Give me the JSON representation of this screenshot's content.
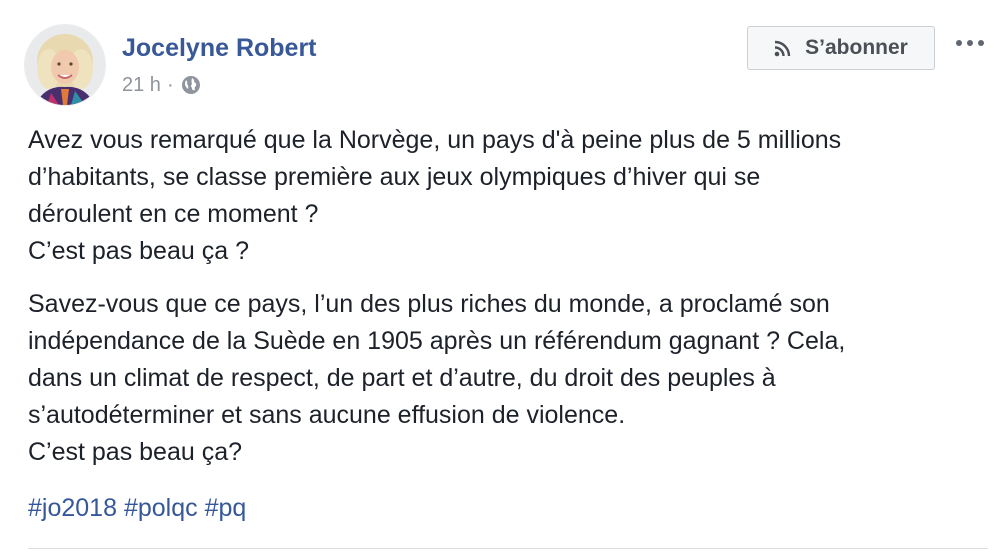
{
  "post": {
    "author": {
      "name": "Jocelyne Robert"
    },
    "meta": {
      "time": "21 h",
      "separator": "·",
      "audience_icon": "globe-icon"
    },
    "subscribe_button": {
      "label": "S’abonner",
      "icon": "rss-icon"
    },
    "more_button": {
      "icon": "more-options-icon"
    },
    "body": {
      "paragraph1_lines": [
        "Avez vous remarqué que la Norvège, un pays d'à peine plus de 5 millions",
        "d’habitants, se classe première aux jeux olympiques d’hiver qui se",
        "déroulent en ce moment ?",
        "C’est pas beau ça ?"
      ],
      "paragraph2_lines": [
        "Savez-vous que ce pays, l’un des plus riches du monde, a proclamé son",
        "indépendance de la Suède en 1905 après un référendum gagnant ? Cela,",
        "dans un climat de respect, de part et d’autre, du droit des peuples à",
        "s’autodéterminer et sans aucune effusion de violence.",
        "C’est pas beau ça?"
      ]
    },
    "hashtags": [
      "#jo2018",
      "#polqc",
      "#pq"
    ]
  },
  "colors": {
    "link_blue": "#385898",
    "meta_gray": "#90949c",
    "text": "#1d2129",
    "button_bg": "#f6f7f9",
    "button_border": "#ccd0d5"
  }
}
